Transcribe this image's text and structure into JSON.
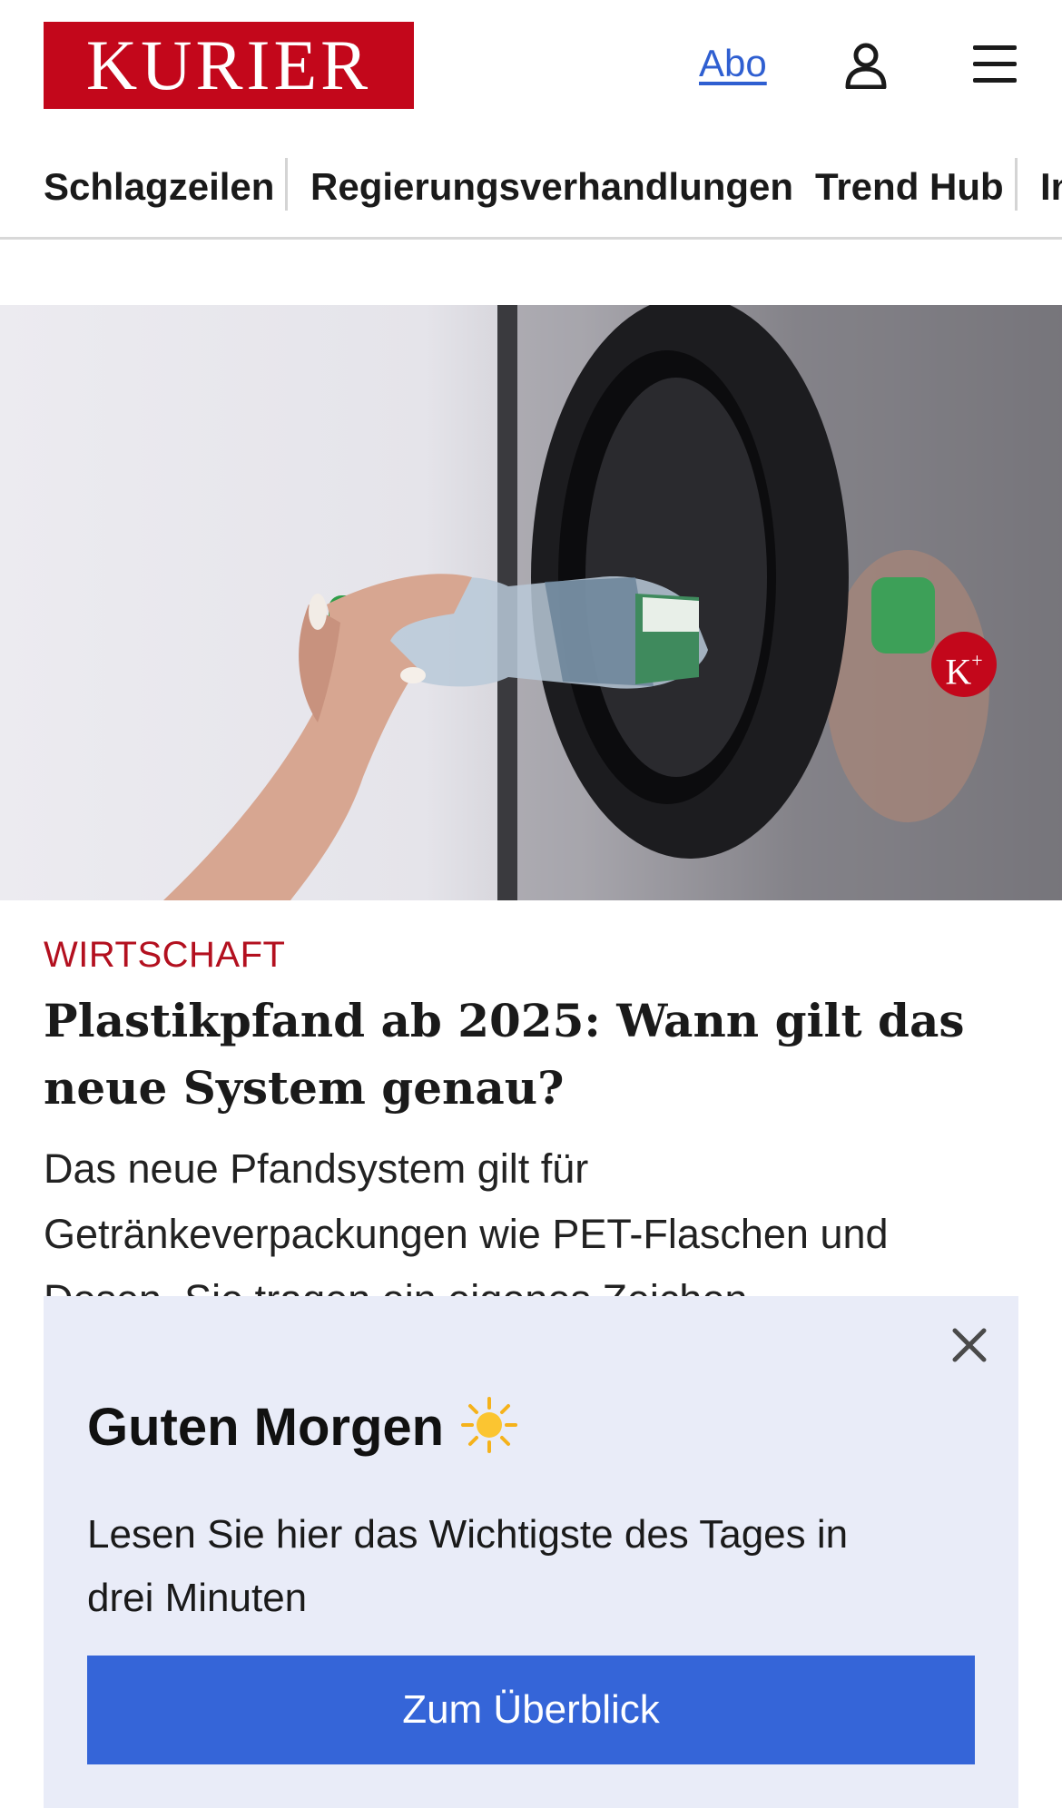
{
  "header": {
    "logo_text": "KURIER",
    "abo_label": "Abo",
    "user_icon": "user-icon",
    "menu_icon": "hamburger-menu-icon"
  },
  "nav": {
    "items": [
      {
        "label": "Schlagzeilen"
      },
      {
        "label": "Regierungsverhandlungen"
      },
      {
        "label": "Trend Hub"
      },
      {
        "label": "In"
      }
    ]
  },
  "article": {
    "premium_badge": "K",
    "category": "WIRTSCHAFT",
    "headline": "Plastikpfand ab 2025: Wann gilt das neue System genau?",
    "teaser": "Das neue Pfandsystem gilt für Getränkeverpackungen wie PET-Flaschen und Dosen. Sie tragen ein eigenes Zeichen."
  },
  "popup": {
    "title": "Guten Morgen",
    "title_icon": "sun-icon",
    "text": "Lesen Sie hier das Wichtigste des Tages in drei Minuten",
    "button_label": "Zum Überblick",
    "close_icon": "close-icon"
  },
  "colors": {
    "brand_red": "#c3071b",
    "link_blue": "#2f5fd1",
    "button_blue": "#3565d8",
    "popup_bg": "#e9ecf8"
  }
}
